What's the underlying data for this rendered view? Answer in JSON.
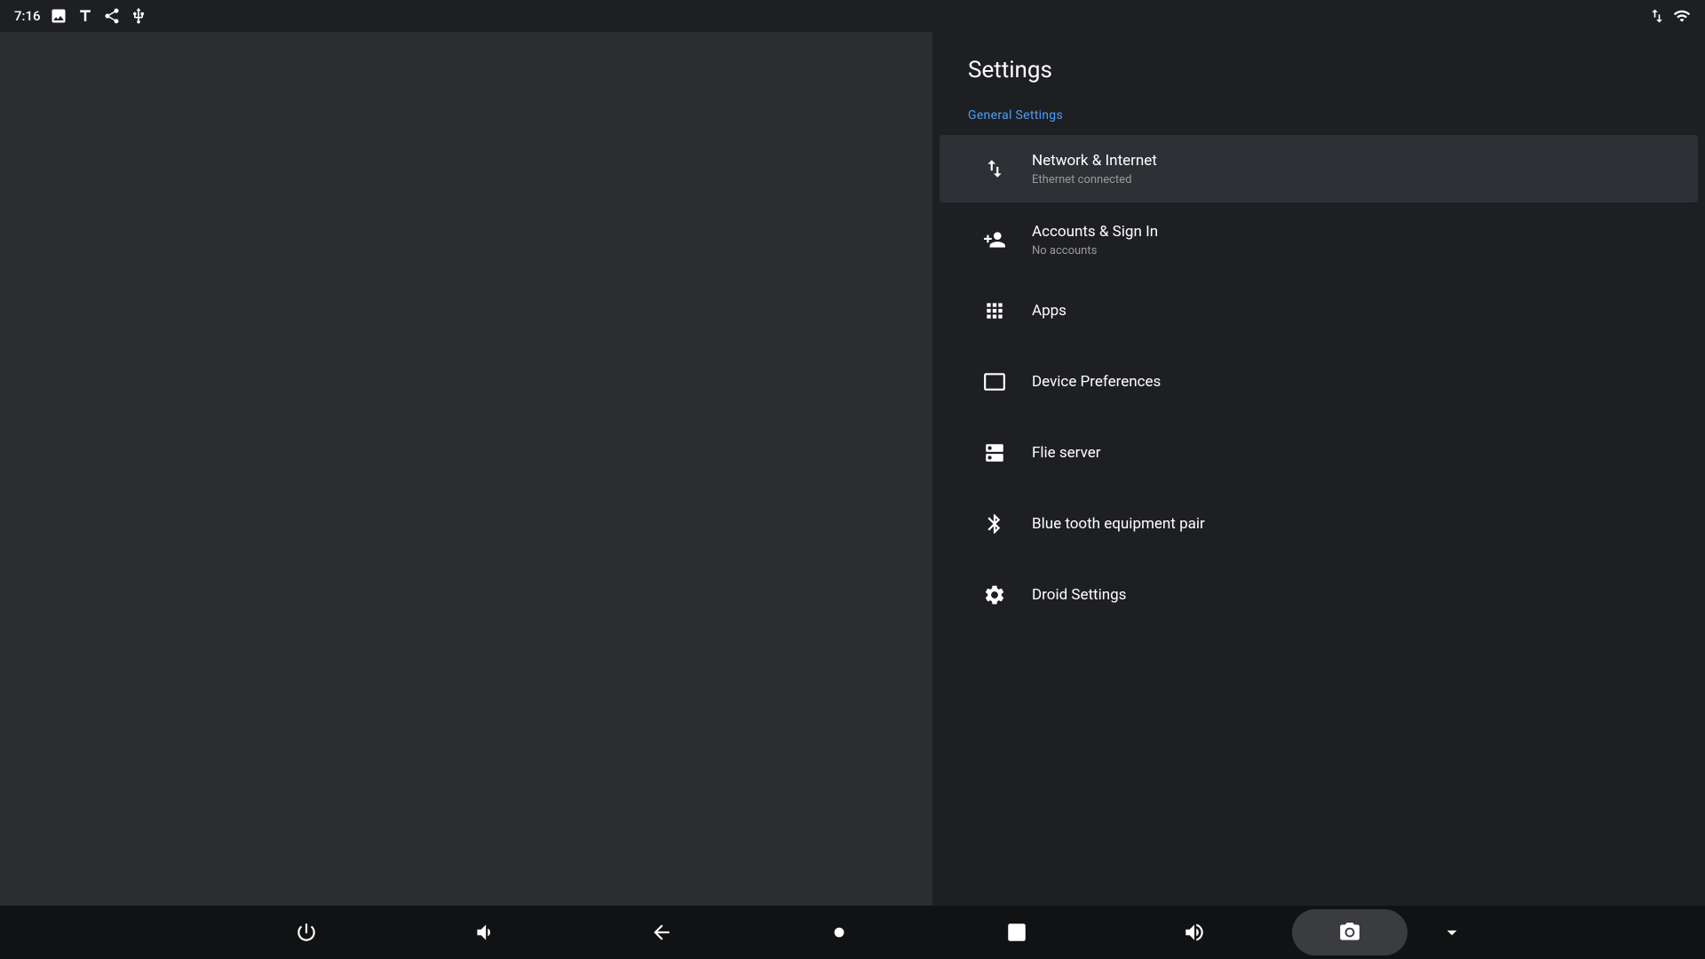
{
  "statusBar": {
    "time": "7:16",
    "icons": [
      "gallery",
      "text",
      "share",
      "usb"
    ]
  },
  "statusBarRight": {
    "icons": [
      "network",
      "signal"
    ]
  },
  "settings": {
    "title": "Settings",
    "sectionLabel": "General Settings",
    "items": [
      {
        "id": "network",
        "title": "Network & Internet",
        "subtitle": "Ethernet connected",
        "icon": "network-icon",
        "active": true
      },
      {
        "id": "accounts",
        "title": "Accounts & Sign In",
        "subtitle": "No accounts",
        "icon": "accounts-icon",
        "active": false
      },
      {
        "id": "apps",
        "title": "Apps",
        "subtitle": "",
        "icon": "apps-icon",
        "active": false
      },
      {
        "id": "device",
        "title": "Device Preferences",
        "subtitle": "",
        "icon": "device-icon",
        "active": false
      },
      {
        "id": "fileserver",
        "title": "Flie server",
        "subtitle": "",
        "icon": "fileserver-icon",
        "active": false
      },
      {
        "id": "bluetooth",
        "title": "Blue tooth equipment pair",
        "subtitle": "",
        "icon": "bluetooth-icon",
        "active": false
      },
      {
        "id": "droid",
        "title": "Droid Settings",
        "subtitle": "",
        "icon": "droid-icon",
        "active": false
      }
    ]
  },
  "navBar": {
    "buttons": [
      "power",
      "volume-down",
      "back",
      "home",
      "stop",
      "volume-up",
      "camera",
      "dropdown"
    ]
  }
}
